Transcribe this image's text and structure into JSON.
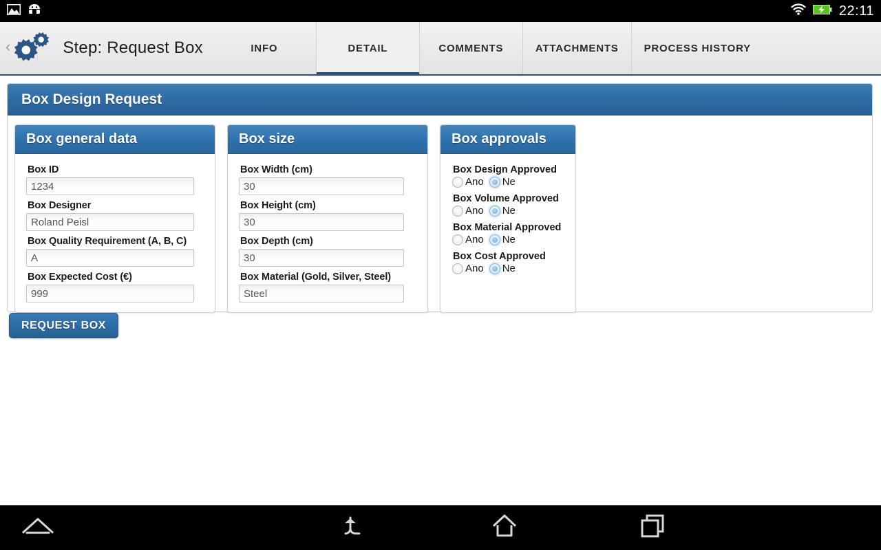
{
  "statusbar": {
    "icons": [
      "screenshot-icon",
      "android-robot-icon",
      "wifi-icon",
      "battery-charging-icon"
    ],
    "clock": "22:11",
    "battery_color": "#5ac31a"
  },
  "actionbar": {
    "back_chevron": "‹",
    "app_icon": "gears-icon",
    "title": "Step: Request Box",
    "accent_color": "#2a4d79",
    "tabs": [
      {
        "label": "INFO",
        "active": false
      },
      {
        "label": "DETAIL",
        "active": true
      },
      {
        "label": "COMMENTS",
        "active": false
      },
      {
        "label": "ATTACHMENTS",
        "active": false
      },
      {
        "label": "PROCESS HISTORY",
        "active": false
      }
    ]
  },
  "form": {
    "card_title": "Box Design Request",
    "header_color": "#2d6ca6",
    "panels": [
      {
        "title": "Box general data",
        "fields": [
          {
            "label": "Box ID",
            "value": "1234"
          },
          {
            "label": "Box Designer",
            "value": "Roland Peisl"
          },
          {
            "label": "Box Quality Requirement (A, B, C)",
            "value": "A"
          },
          {
            "label": "Box Expected Cost (€)",
            "value": "999"
          }
        ]
      },
      {
        "title": "Box size",
        "fields": [
          {
            "label": "Box Width (cm)",
            "value": "30"
          },
          {
            "label": "Box Height (cm)",
            "value": "30"
          },
          {
            "label": "Box Depth (cm)",
            "value": "30"
          },
          {
            "label": "Box Material (Gold, Silver, Steel)",
            "value": "Steel"
          }
        ]
      }
    ],
    "approvals_panel": {
      "title": "Box approvals",
      "option_yes": "Ano",
      "option_no": "Ne",
      "items": [
        {
          "label": "Box Design Approved",
          "selected": "Ne"
        },
        {
          "label": "Box Volume Approved",
          "selected": "Ne"
        },
        {
          "label": "Box Material Approved",
          "selected": "Ne"
        },
        {
          "label": "Box Cost Approved",
          "selected": "Ne"
        }
      ]
    },
    "submit_label": "REQUEST BOX"
  },
  "navbar": {
    "buttons": [
      {
        "name": "app-up-icon"
      },
      {
        "name": "back-icon"
      },
      {
        "name": "home-icon"
      },
      {
        "name": "recents-icon"
      }
    ]
  }
}
